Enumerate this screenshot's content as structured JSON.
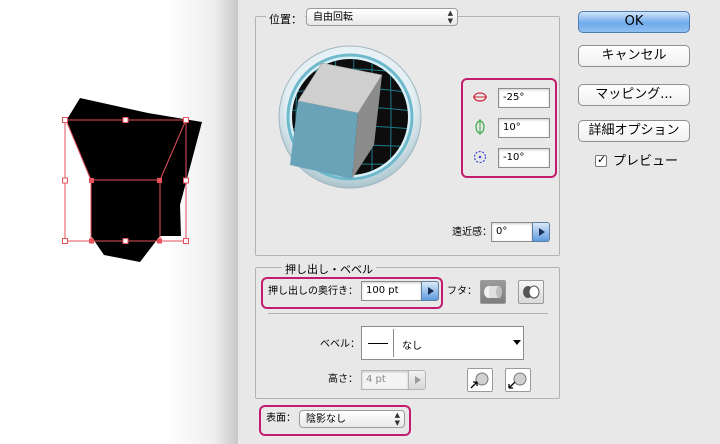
{
  "rotation": {
    "position_label": "位置：",
    "position_value": "自由回転",
    "x_angle": "-25°",
    "y_angle": "10°",
    "z_angle": "-10°",
    "perspective_label": "遠近感：",
    "perspective_value": "0°"
  },
  "extrude": {
    "section_title": "押し出し・ベベル",
    "depth_label": "押し出しの奥行き：",
    "depth_value": "100 pt",
    "cap_label": "フタ：",
    "bevel_label": "ベベル：",
    "bevel_value": "なし",
    "height_label": "高さ：",
    "height_value": "4 pt"
  },
  "surface": {
    "label": "表面：",
    "value": "陰影なし"
  },
  "buttons": {
    "ok": "OK",
    "cancel": "キャンセル",
    "mapping": "マッピング...",
    "more_options": "詳細オプション",
    "preview": "プレビュー"
  },
  "colors": {
    "highlight": "#c21d6d",
    "cube_front": "#6aa3b8",
    "selection": "#e8505b"
  },
  "icons": [
    "x-axis-rotate-icon",
    "y-axis-rotate-icon",
    "z-axis-rotate-icon",
    "cap-on-icon",
    "cap-off-icon",
    "bevel-out-icon",
    "bevel-in-icon",
    "checkbox-checked-icon"
  ]
}
